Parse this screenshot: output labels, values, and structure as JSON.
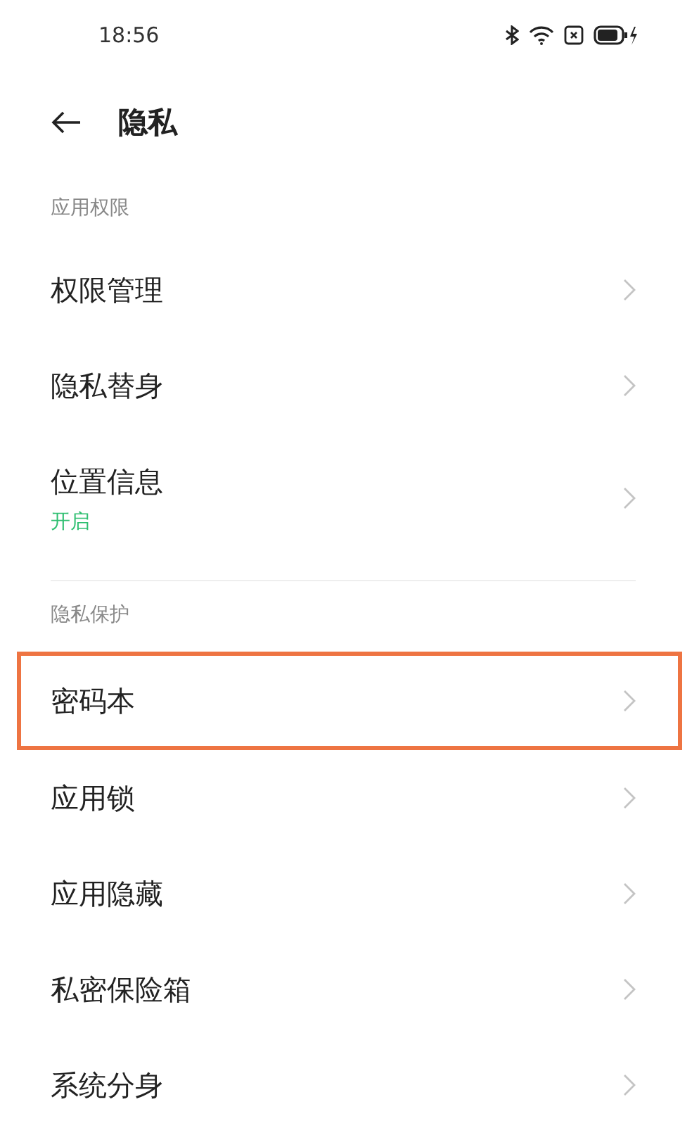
{
  "status_bar": {
    "time": "18:56"
  },
  "header": {
    "title": "隐私"
  },
  "sections": [
    {
      "title": "应用权限",
      "items": [
        {
          "label": "权限管理",
          "highlighted": false
        },
        {
          "label": "隐私替身",
          "highlighted": false
        },
        {
          "label": "位置信息",
          "status": "开启",
          "highlighted": false
        }
      ]
    },
    {
      "title": "隐私保护",
      "items": [
        {
          "label": "密码本",
          "highlighted": true
        },
        {
          "label": "应用锁",
          "highlighted": false
        },
        {
          "label": "应用隐藏",
          "highlighted": false
        },
        {
          "label": "私密保险箱",
          "highlighted": false
        },
        {
          "label": "系统分身",
          "highlighted": false
        }
      ]
    }
  ]
}
